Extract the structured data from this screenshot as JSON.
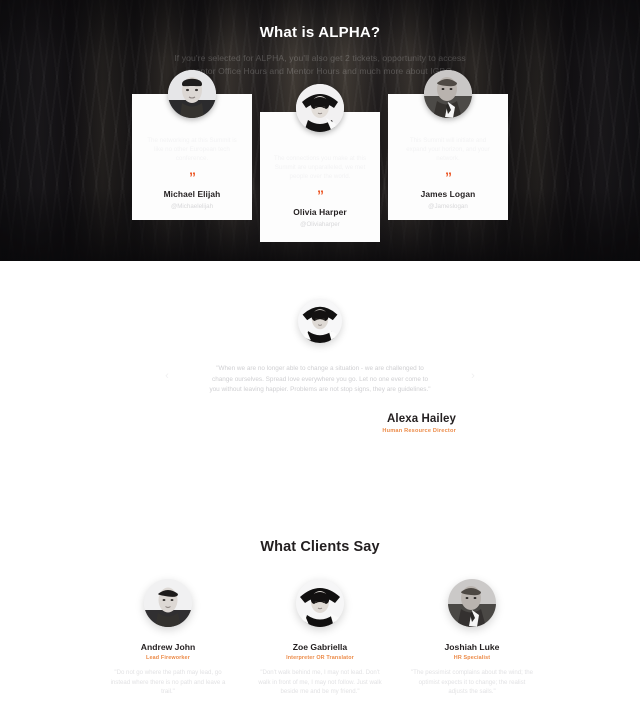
{
  "theme": {
    "accent": "#ec5b2b",
    "accent_soft": "#ec8a47",
    "dark_bg": "#17161a",
    "card_bg": "#fdfdfd",
    "page_bg": "#ffffff",
    "heading": "#231f20"
  },
  "hero": {
    "title": "What is ALPHA?",
    "subtitle": "If you're selected for ALPHA, you'll also get 2 tickets, opportunity to access mentor Office Hours and Mentor Hours and much more about IGBC",
    "quote_mark": "”",
    "cards": [
      {
        "quote": "The networking at this Summit is like no other European tech conference.",
        "name": "Michael Elijah",
        "handle": "@Michaelelijah"
      },
      {
        "quote": "The connections you make at this Summit are unparalleled, we met people over the world.",
        "name": "Olivia Harper",
        "handle": "@Oliviaharper"
      },
      {
        "quote": "This Summit will initiate and expand your horizon, and your network.",
        "name": "James Logan",
        "handle": "@Jameslogan"
      }
    ]
  },
  "featured": {
    "quote": "\"When we are no longer able to change a situation - we are challenged to change ourselves. Spread love everywhere you go. Let no one ever come to you without leaving happier. Problems are not stop signs, they are guidelines.\"",
    "name": "Alexa Hailey",
    "role": "Human Resource Director",
    "prev_label": "‹",
    "next_label": "›"
  },
  "clients": {
    "title": "What Clients Say",
    "items": [
      {
        "name": "Andrew John",
        "role": "Lead Fireworker",
        "quote": "\"Do not go where the path may lead, go instead where there is no path and leave a trail.\""
      },
      {
        "name": "Zoe Gabriella",
        "role": "Interpreter OR Translator",
        "quote": "\"Don't walk behind me, I may not lead. Don't walk in front of me, I may not follow. Just walk beside me and be my friend.\""
      },
      {
        "name": "Joshiah Luke",
        "role": "HR Specialist",
        "quote": "\"The pessimist complains about the wind; the optimist expects it to change; the realist adjusts the sails.\""
      }
    ]
  }
}
